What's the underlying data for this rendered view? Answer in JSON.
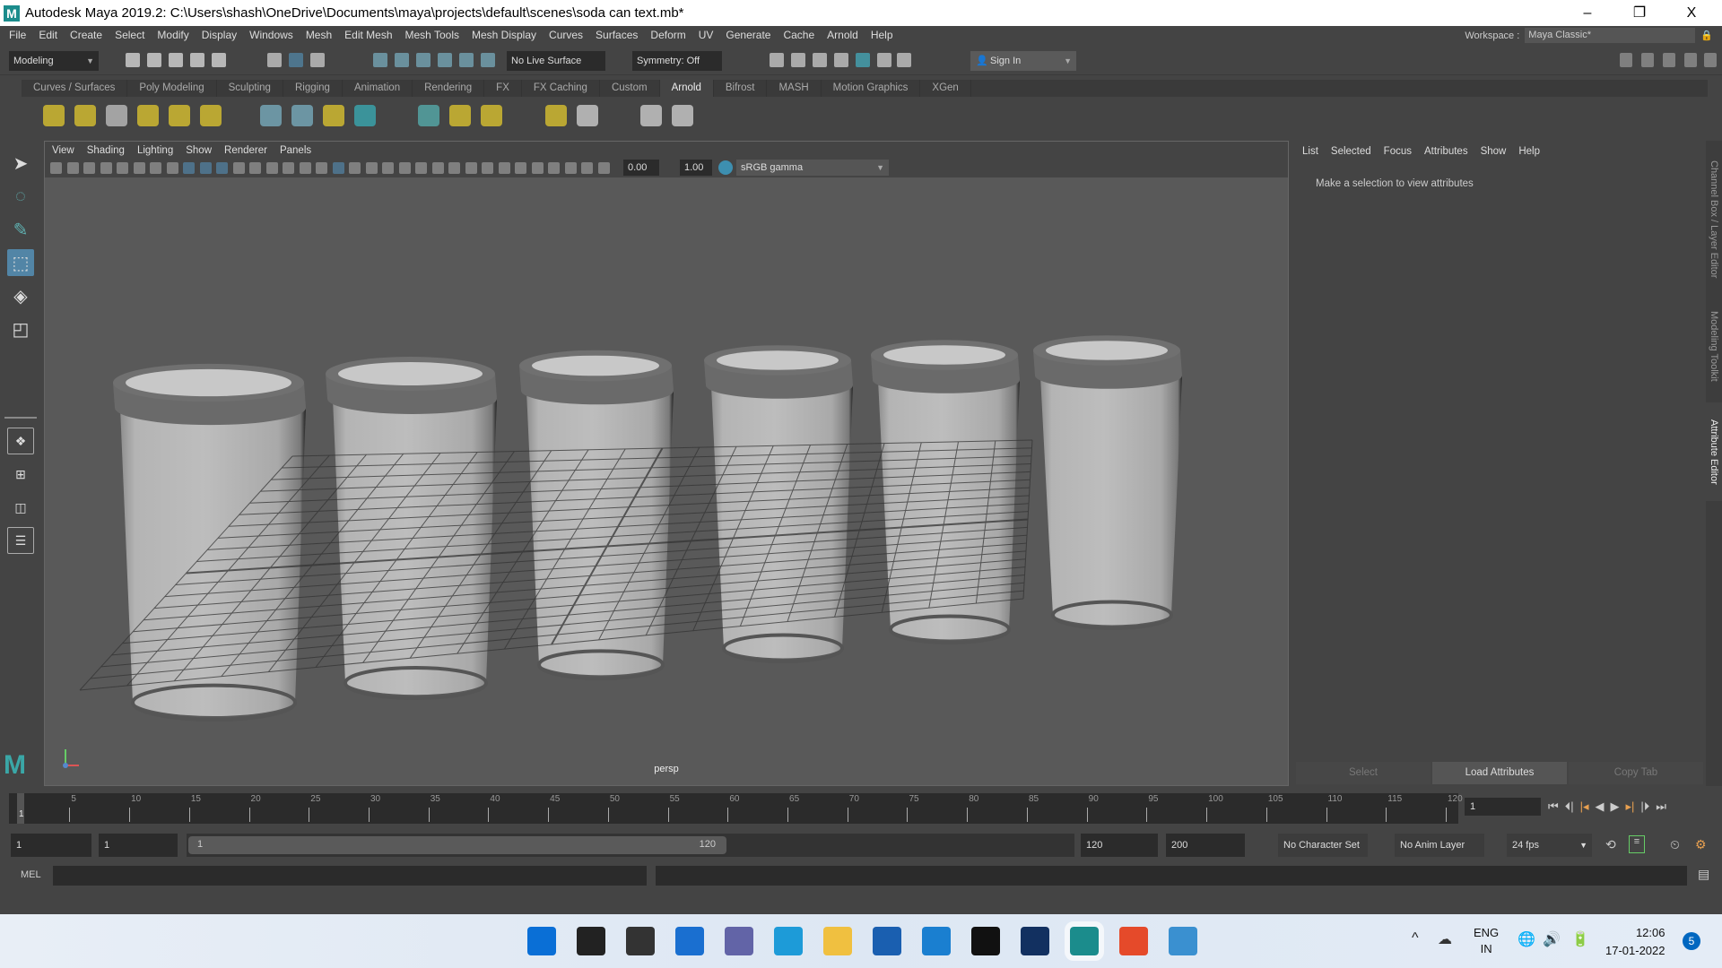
{
  "window": {
    "title": "Autodesk Maya 2019.2: C:\\Users\\shash\\OneDrive\\Documents\\maya\\projects\\default\\scenes\\soda can text.mb*",
    "logo": "M",
    "minimize": "–",
    "maximize": "❐",
    "close": "X"
  },
  "menu": [
    "File",
    "Edit",
    "Create",
    "Select",
    "Modify",
    "Display",
    "Windows",
    "Mesh",
    "Edit Mesh",
    "Mesh Tools",
    "Mesh Display",
    "Curves",
    "Surfaces",
    "Deform",
    "UV",
    "Generate",
    "Cache",
    "Arnold",
    "Help"
  ],
  "workspace": {
    "label": "Workspace :",
    "value": "Maya Classic*"
  },
  "status": {
    "mode": "Modeling",
    "live_surface": "No Live Surface",
    "symmetry": "Symmetry: Off",
    "sign_in": "Sign In"
  },
  "shelf_tabs": [
    "Curves / Surfaces",
    "Poly Modeling",
    "Sculpting",
    "Rigging",
    "Animation",
    "Rendering",
    "FX",
    "FX Caching",
    "Custom",
    "Arnold",
    "Bifrost",
    "MASH",
    "Motion Graphics",
    "XGen"
  ],
  "shelf_active": "Arnold",
  "viewport": {
    "menu": [
      "View",
      "Shading",
      "Lighting",
      "Show",
      "Renderer",
      "Panels"
    ],
    "exposure": "0.00",
    "gamma": "1.00",
    "color_space": "sRGB gamma",
    "camera": "persp"
  },
  "attribute_editor": {
    "menu": [
      "List",
      "Selected",
      "Focus",
      "Attributes",
      "Show",
      "Help"
    ],
    "message": "Make a selection to view attributes",
    "buttons": [
      "Select",
      "Load Attributes",
      "Copy Tab"
    ]
  },
  "side_tabs": [
    "Channel Box / Layer Editor",
    "Modeling Toolkit",
    "Attribute Editor"
  ],
  "timeline": {
    "start": 1,
    "end": 120,
    "labels": [
      5,
      10,
      15,
      20,
      25,
      30,
      35,
      40,
      45,
      50,
      55,
      60,
      65,
      70,
      75,
      80,
      85,
      90,
      95,
      100,
      105,
      110,
      115,
      120
    ],
    "current_frame": "1",
    "current_label": "1"
  },
  "range": {
    "start": "1",
    "playback_start": "1",
    "slider_start": "1",
    "slider_end": "120",
    "playback_end": "120",
    "end": "200",
    "character_set": "No Character Set",
    "anim_layer": "No Anim Layer",
    "fps": "24 fps"
  },
  "command": {
    "label": "MEL"
  },
  "taskbar": {
    "lang": "ENG",
    "region": "IN",
    "time": "12:06",
    "date": "17-01-2022",
    "notifications": "5",
    "chevron": "^"
  },
  "colors": {
    "accent": "#5285a6",
    "viewport_bg": "#595959",
    "panel": "#444444"
  }
}
